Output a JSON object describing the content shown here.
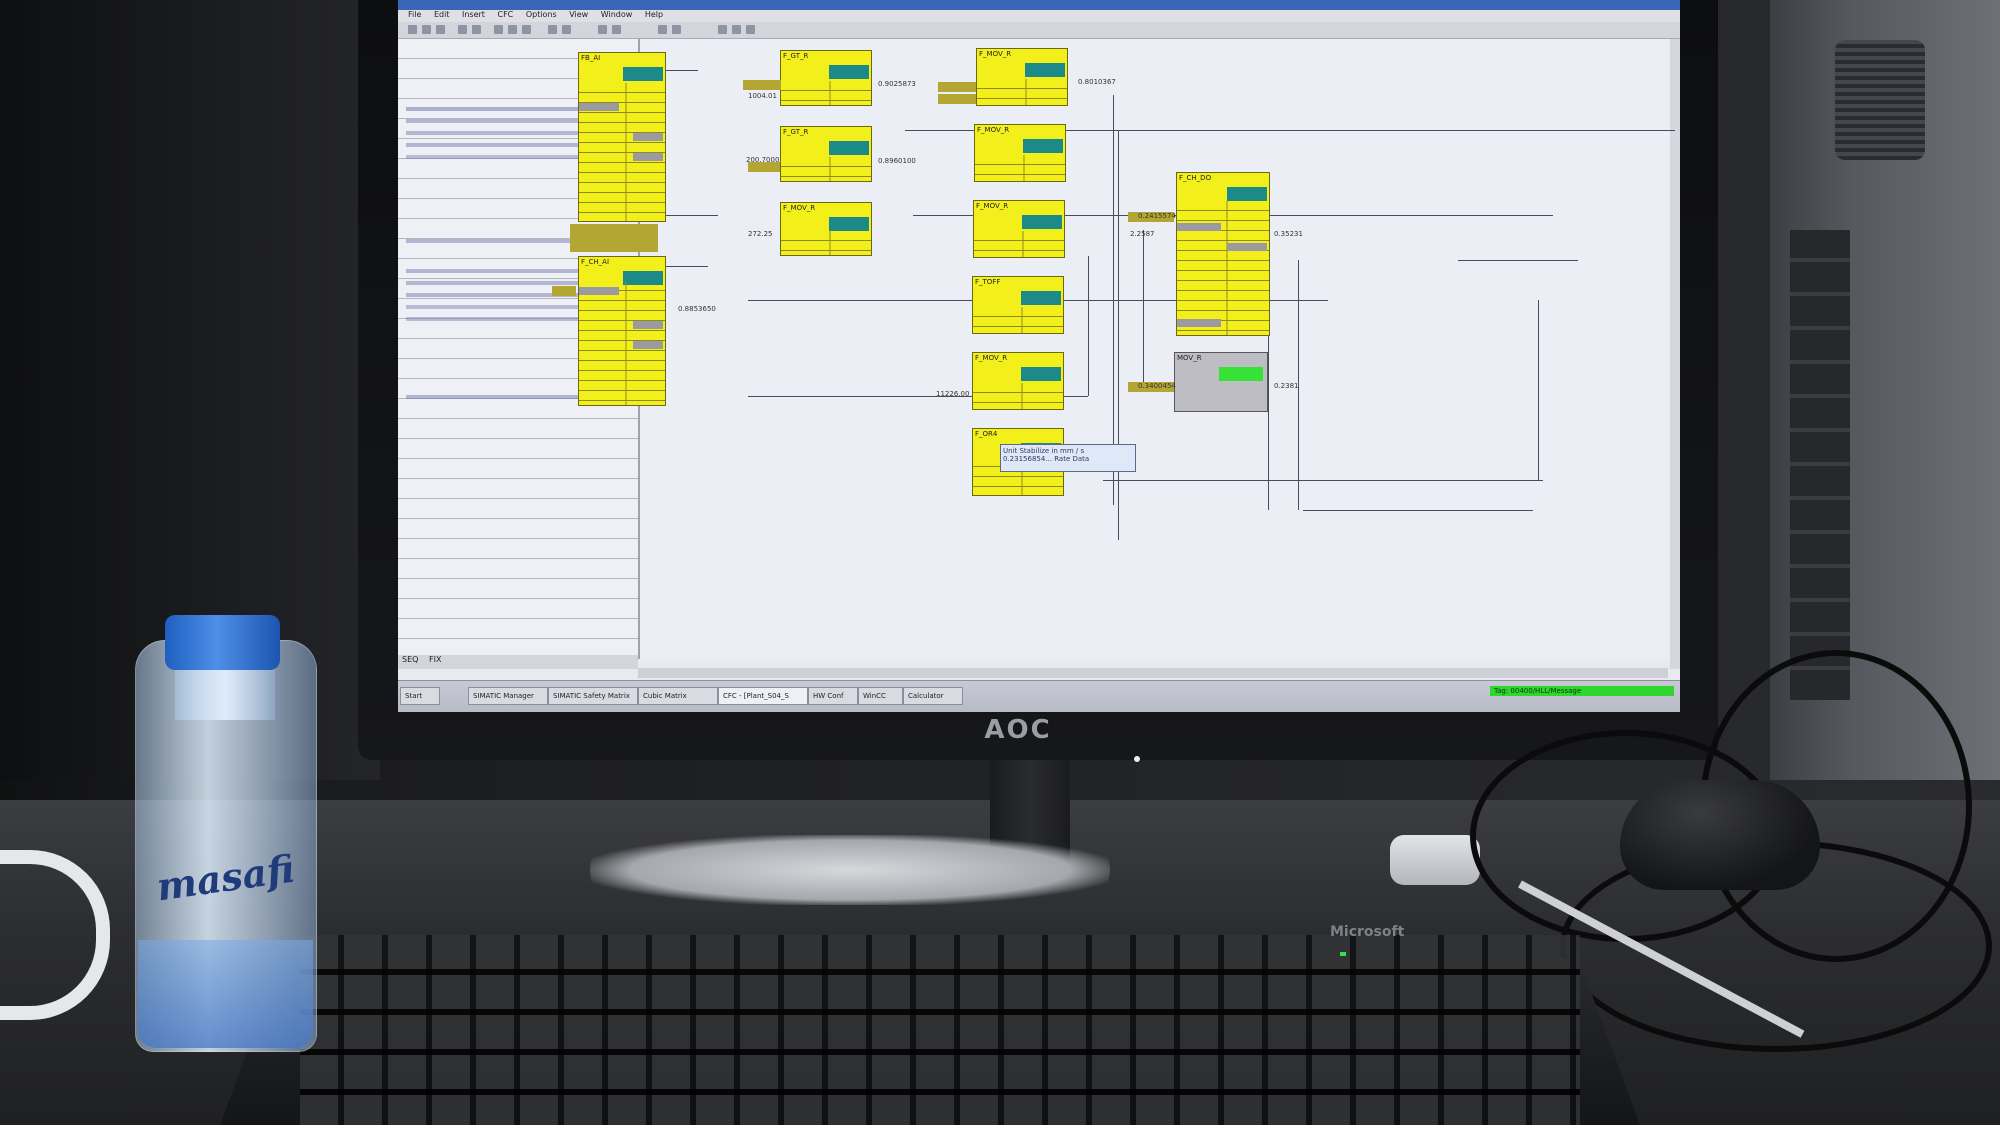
{
  "monitor": {
    "brand": "AOC"
  },
  "keyboard": {
    "brand": "Microsoft"
  },
  "bottle": {
    "label": "masafi"
  },
  "screen": {
    "menu_items": [
      "File",
      "Edit",
      "Insert",
      "CFC",
      "Options",
      "View",
      "Window",
      "Help"
    ],
    "side_tabs": [
      "SEQ",
      "FIX"
    ],
    "comment": [
      "Unit Stabilize in mm / s",
      "0.23156854... Rate Data"
    ],
    "status_text": "Tag: 00400/HLL/Message",
    "taskbar_items": [
      "Start",
      "SIMATIC Manager",
      "SIMATIC Safety Matrix",
      "Cubic Matrix",
      "CFC - [Plant_S04_S",
      "HW Conf",
      "WinCC",
      "Calculator"
    ],
    "blocks": [
      {
        "name": "FB_AI"
      },
      {
        "name": "F_CH_AI"
      },
      {
        "name": "F_GT_R"
      },
      {
        "name": "F_GT_R"
      },
      {
        "name": "F_MOV_R"
      },
      {
        "name": "F_MOV_R"
      },
      {
        "name": "F_MOV_R"
      },
      {
        "name": "F_MOV_R"
      },
      {
        "name": "F_TOFF"
      },
      {
        "name": "F_MOV_R"
      },
      {
        "name": "F_OR4"
      },
      {
        "name": "F_CH_DO"
      },
      {
        "name": "MOV_R"
      }
    ],
    "values": [
      "1004.01",
      "0.9025873",
      "0.8010367",
      "0.8960100",
      "200.7000",
      "0.8853650",
      "272.25",
      "0.2415574",
      "2.2587",
      "0.3400454",
      "11226.00",
      "0.35231",
      "0.2381"
    ]
  }
}
